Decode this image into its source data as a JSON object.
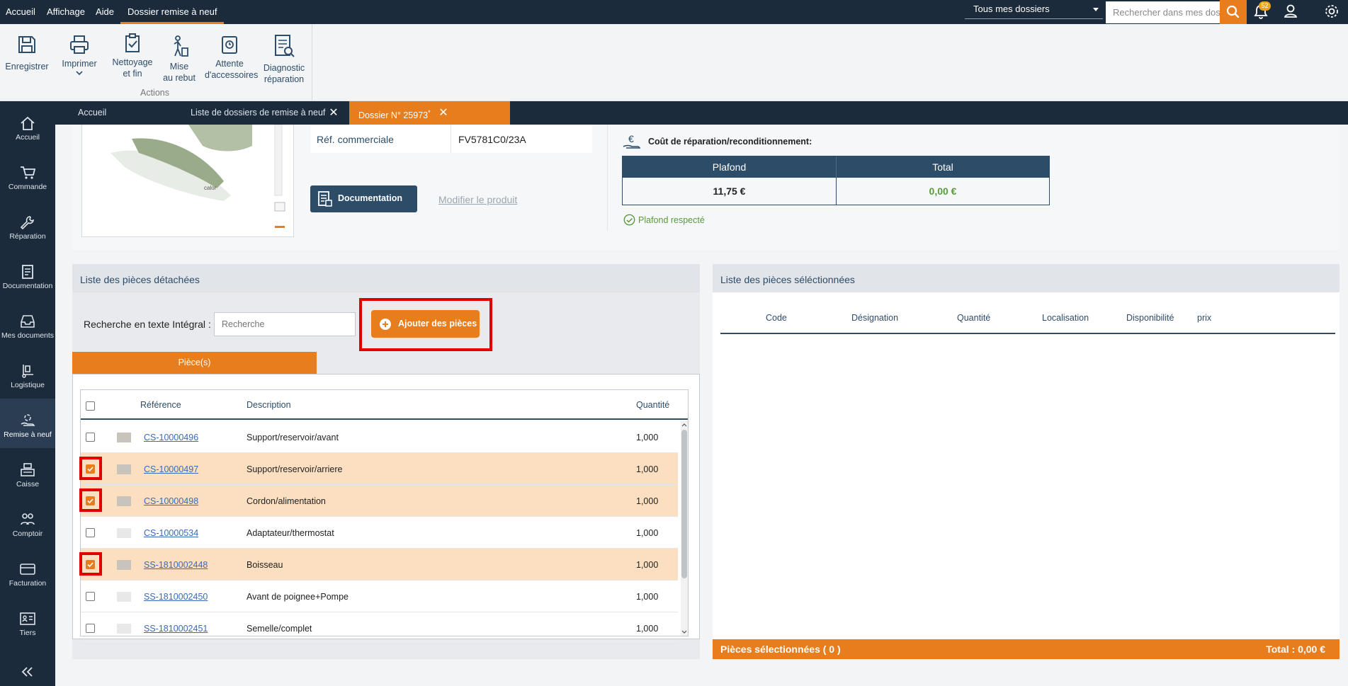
{
  "topbar": {
    "menus": [
      "Accueil",
      "Affichage",
      "Aide",
      "Dossier remise à neuf"
    ],
    "folder_select": "Tous mes dossiers",
    "search_placeholder": "Rechercher dans mes dossiers",
    "notifications_count": "52"
  },
  "ribbon": {
    "buttons": [
      "Enregistrer",
      "Imprimer",
      "Nettoyage\net fin",
      "Mise\nau rebut",
      "Attente\nd'accessoires",
      "Diagnostic\nréparation"
    ],
    "group_label": "Actions"
  },
  "sidebar": {
    "items": [
      "Accueil",
      "Commande",
      "Réparation",
      "Documentation",
      "Mes documents",
      "Logistique",
      "Remise à neuf",
      "Caisse",
      "Comptoir",
      "Facturation",
      "Tiers"
    ],
    "active": "Remise à neuf"
  },
  "tabs": [
    {
      "label": "Accueil"
    },
    {
      "label": "Liste de dossiers de remise à neuf"
    },
    {
      "label": "Dossier N° 25973",
      "modified_marker": "*"
    }
  ],
  "product": {
    "ref_label": "Réf. commerciale",
    "ref_value": "FV5781C0/23A",
    "doc_button": "Documentation",
    "modify_link": "Modifier le produit"
  },
  "cost": {
    "title": "Coût de réparation/reconditionnement:",
    "col_plafond": "Plafond",
    "col_total": "Total",
    "plafond_value": "11,75 €",
    "total_value": "0,00 €",
    "status": "Plafond respecté"
  },
  "parts": {
    "title": "Liste des pièces détachées",
    "search_label": "Recherche en texte Intégral :",
    "search_placeholder": "Recherche",
    "add_button": "Ajouter des pièces",
    "tab_label": "Pièce(s)",
    "columns": {
      "reference": "Référence",
      "description": "Description",
      "quantity": "Quantité"
    },
    "rows": [
      {
        "ref": "CS-10000496",
        "desc": "Support/reservoir/avant",
        "qty": "1,000",
        "checked": false,
        "has_image": true
      },
      {
        "ref": "CS-10000497",
        "desc": "Support/reservoir/arriere",
        "qty": "1,000",
        "checked": true,
        "has_image": true
      },
      {
        "ref": "CS-10000498",
        "desc": "Cordon/alimentation",
        "qty": "1,000",
        "checked": true,
        "has_image": true
      },
      {
        "ref": "CS-10000534",
        "desc": "Adaptateur/thermostat",
        "qty": "1,000",
        "checked": false,
        "has_image": false
      },
      {
        "ref": "SS-1810002448",
        "desc": "Boisseau",
        "qty": "1,000",
        "checked": true,
        "has_image": true
      },
      {
        "ref": "SS-1810002450",
        "desc": "Avant de poignee+Pompe",
        "qty": "1,000",
        "checked": false,
        "has_image": false
      },
      {
        "ref": "SS-1810002451",
        "desc": "Semelle/complet",
        "qty": "1,000",
        "checked": false,
        "has_image": false
      }
    ]
  },
  "selected": {
    "title": "Liste des pièces séléctionnées",
    "columns": [
      "Code",
      "Désignation",
      "Quantité",
      "Localisation",
      "Disponibilité",
      "prix"
    ],
    "footer_count": "Pièces sélectionnées ( 0 )",
    "footer_total": "Total : 0,00 €"
  },
  "colors": {
    "accent": "#e87d1e",
    "navy": "#1c2b3b",
    "header_blue": "#2d4c68",
    "highlight_red": "#e00000",
    "selected_row": "#fbdfc0"
  }
}
